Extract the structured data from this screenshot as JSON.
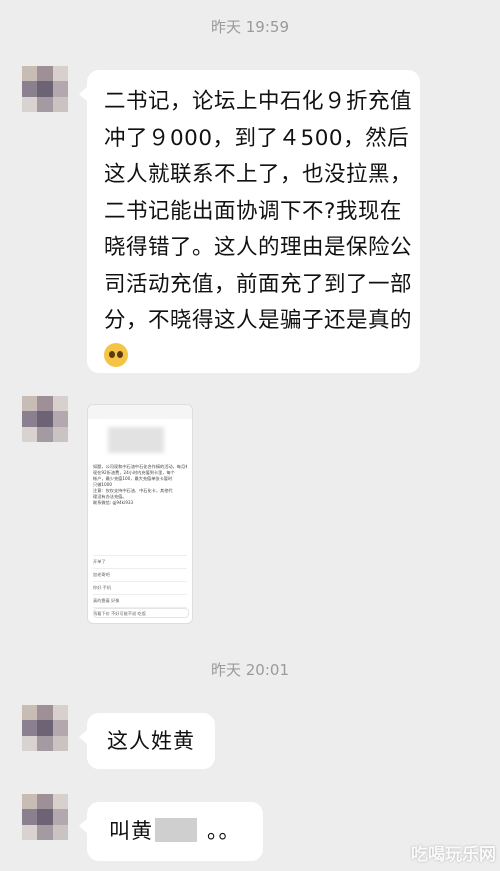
{
  "timestamps": [
    "昨天 19:59",
    "昨天 20:01"
  ],
  "messages": [
    {
      "text": "二书记，论坛上中石化９折充值冲了９000，到了４500，然后这人就联系不上了，也没拉黑，二书记能出面协调下不?我现在晓得错了。这人的理由是保险公司活动充值，前面充了到了一部分，不晓得这人是骗子还是真的",
      "emoji": "pleading-face-emoji"
    },
    {
      "type": "image",
      "screenshot_text": [
        "如题，公司现和中石油中石化合作搞的活动，每月有几万金额",
        "现在92折油费，24小时内充值到卡里，每个",
        "帐户，最少充值100，最大充值单张卡暂时",
        "只做1000",
        "注意：仅仅支持中石油、中石化卡，其他代",
        "理没有办法充值。",
        "联系微信: gj94ki933"
      ],
      "screenshot_replies": [
        "开单了",
        "加老哥吧",
        "你好 手机",
        "真的靠着 好像",
        "再看下价 不好可能不说 吃饭"
      ]
    },
    {
      "text": "这人姓黄"
    },
    {
      "text_before": "叫黄",
      "text_after": "。。"
    }
  ],
  "watermark": "吃喝玩乐网",
  "colors": {
    "background": "#ededed",
    "bubble": "#ffffff",
    "timestamp": "#9a9a9a"
  }
}
